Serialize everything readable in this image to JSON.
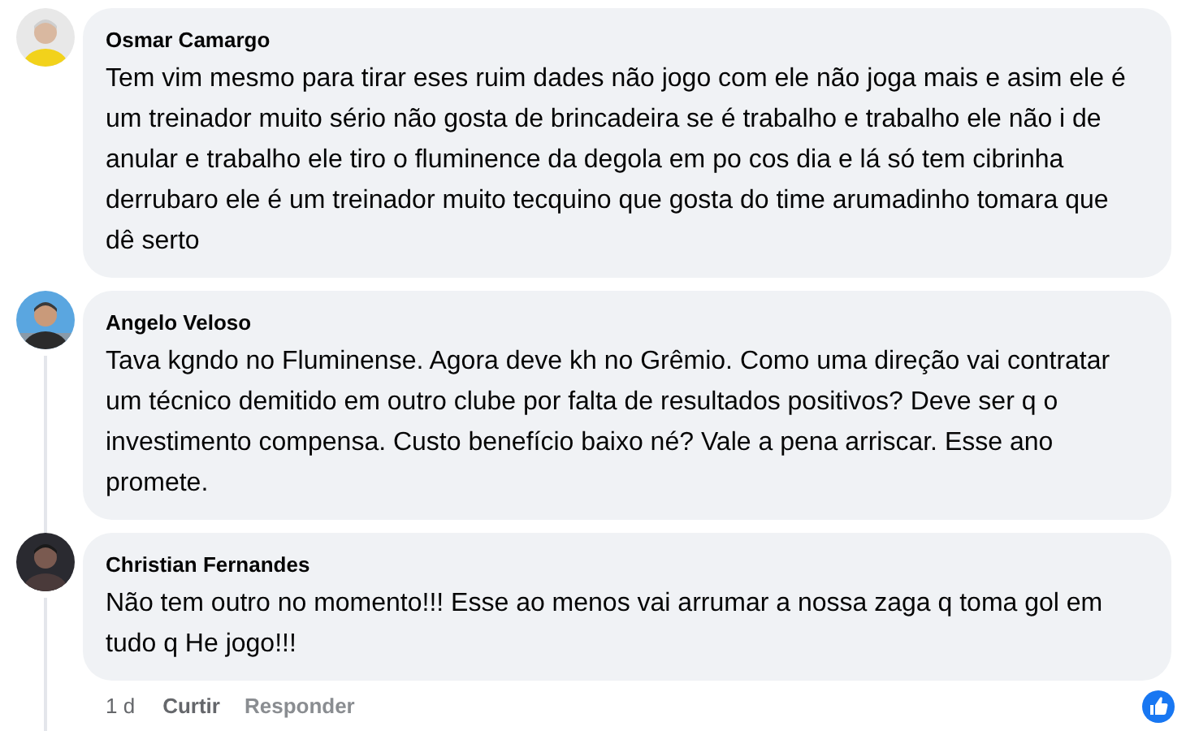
{
  "comments": [
    {
      "author": "Osmar Camargo",
      "text": "Tem vim mesmo para tirar eses ruim dades não jogo com ele não joga mais e asim ele é um treinador muito sério não gosta de brincadeira se é trabalho e trabalho ele não i de anular e trabalho ele tiro o fluminence da degola em po cos dia e lá só tem cibrinha derrubaro ele é um treinador muito tecquino que gosta do time arumadinho tomara que dê serto"
    },
    {
      "author": "Angelo Veloso",
      "text": "Tava kgndo no Fluminense. Agora deve kh no Grêmio. Como uma direção vai contratar um técnico demitido em outro clube por falta de resultados positivos? Deve ser q o investimento compensa. Custo benefício baixo né? Vale a pena arriscar. Esse ano promete."
    },
    {
      "author": "Christian Fernandes",
      "text": "Não tem outro no momento!!! Esse ao menos vai arrumar a nossa zaga q toma gol em tudo q He jogo!!!"
    }
  ],
  "actions": {
    "time": "1 d",
    "like": "Curtir",
    "reply": "Responder"
  }
}
